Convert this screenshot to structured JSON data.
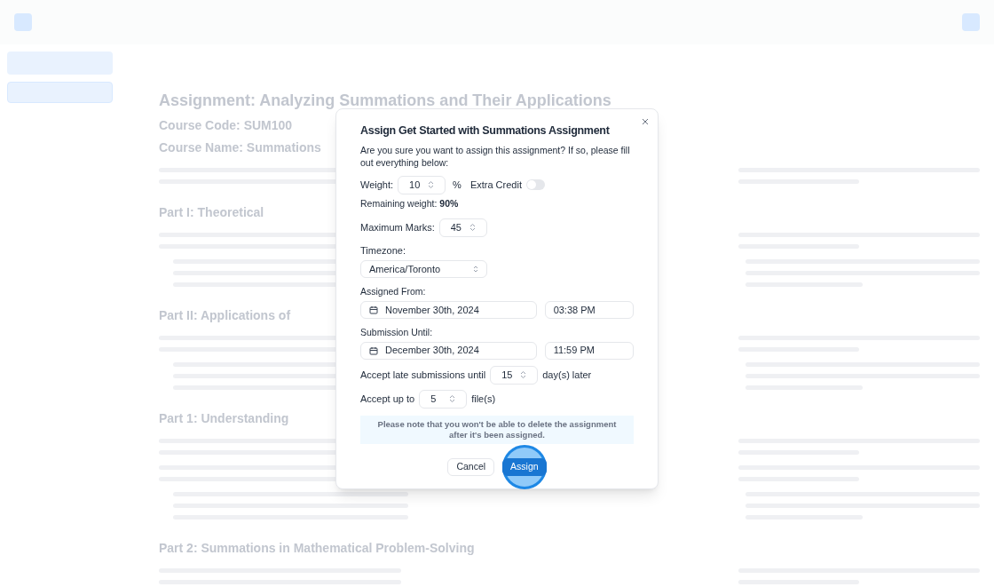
{
  "sidebar": {
    "items": [
      {
        "selected": true
      }
    ]
  },
  "page": {
    "headings": [
      {
        "kind": "h1",
        "text": "Assignment: Analyzing Summations and Their Applications"
      },
      {
        "kind": "h2",
        "text": "Course Code: SUM100"
      },
      {
        "kind": "h2",
        "text": "Course Name: Summations"
      },
      {
        "kind": "para"
      },
      {
        "kind": "h3",
        "text": "Part I: Theoretical"
      },
      {
        "kind": "para"
      },
      {
        "kind": "list"
      },
      {
        "kind": "h3",
        "text": "Part II: Applications of"
      },
      {
        "kind": "para"
      },
      {
        "kind": "list"
      },
      {
        "kind": "h3",
        "text": "Part 1: Understanding"
      },
      {
        "kind": "para"
      },
      {
        "kind": "para"
      },
      {
        "kind": "list"
      },
      {
        "kind": "h3",
        "text": "Part 2: Summations in Mathematical Problem-Solving"
      },
      {
        "kind": "para"
      }
    ]
  },
  "dialog": {
    "title": "Assign Get Started with Summations Assignment",
    "description": "Are you sure you want to assign this assignment? If so, please fill out everything below:",
    "weight": {
      "label": "Weight:",
      "value": "10",
      "unit": "%"
    },
    "extra_credit": {
      "label": "Extra Credit",
      "on": false
    },
    "remaining": "Remaining weight: **90%**",
    "max_marks": {
      "label": "Maximum Marks:",
      "value": "45"
    },
    "timezone": {
      "label": "Timezone:",
      "value": "America/Toronto"
    },
    "assigned_from": {
      "label": "Assigned From:",
      "date": "November 30th, 2024",
      "time": "03:38 PM"
    },
    "submission_until": {
      "label": "Submission Until:",
      "date": "December 30th, 2024",
      "time": "11:59 PM"
    },
    "late": {
      "label": "Accept late submissions until",
      "value": "15",
      "suffix": "day(s) later"
    },
    "files": {
      "label": "Accept up to",
      "value": "5",
      "suffix": "file(s)"
    },
    "notice": "Please note that you won't be able to delete the assignment after it's been assigned.",
    "buttons": [
      "Cancel",
      "Assign"
    ]
  }
}
